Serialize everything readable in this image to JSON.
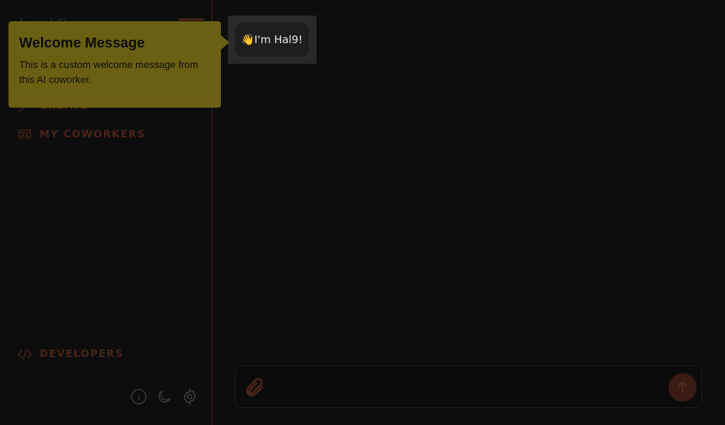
{
  "sidebar": {
    "logo": "hal9",
    "nav": {
      "create": "CREATE",
      "coworkers": "MY COWORKERS",
      "developers": "DEVELOPERS"
    },
    "bottom_icons": [
      "info-icon",
      "moon-icon",
      "gear-icon"
    ]
  },
  "chat": {
    "greeting_emoji": "👋",
    "greeting_text": "I'm Hal9!",
    "input_placeholder": ""
  },
  "tour": {
    "title": "Welcome Message",
    "body": "This is a custom welcome message from this AI coworker."
  },
  "colors": {
    "background": "#0d0d0d",
    "accent": "#4a2418",
    "tooltip": "#6e6314",
    "bubble": "#1e1e1e"
  }
}
